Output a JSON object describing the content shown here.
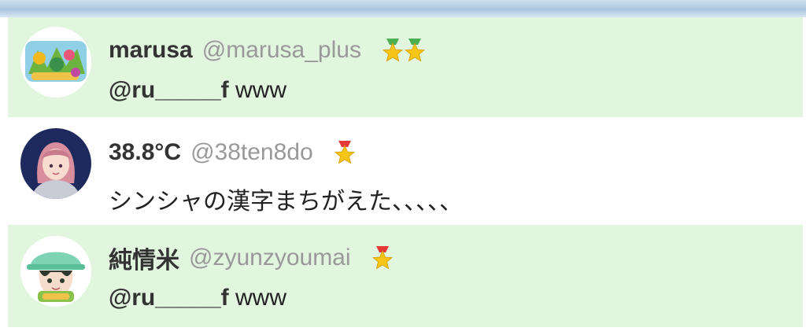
{
  "tweets": [
    {
      "name": "marusa",
      "handle": "@marusa_plus",
      "badge_count": 2,
      "badge_icon": "green-ribbon-star-icon",
      "mention": "@ru_____f",
      "text": " www",
      "highlighted": true
    },
    {
      "name": "38.8°C",
      "handle": "@38ten8do",
      "badge_count": 1,
      "badge_icon": "red-ribbon-star-icon",
      "mention": "",
      "text": "シンシャの漢字まちがえた、、、、、",
      "highlighted": false
    },
    {
      "name": "純情米",
      "handle": "@zyunzyoumai",
      "badge_count": 1,
      "badge_icon": "red-ribbon-star-icon",
      "mention": "@ru_____f",
      "text": " www",
      "highlighted": true
    }
  ],
  "colors": {
    "highlight_bg": "#e1f5df",
    "name": "#333333",
    "handle": "#999999",
    "star": "#f5c518",
    "ribbon_green": "#4caf50",
    "ribbon_red": "#e53935"
  }
}
